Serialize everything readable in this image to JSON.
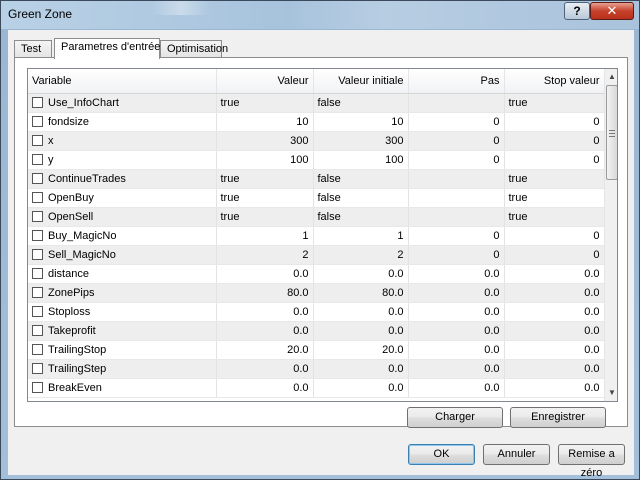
{
  "window": {
    "title": "Green Zone",
    "help_glyph": "?",
    "close_glyph": "✕"
  },
  "tabs": [
    {
      "label": "Test"
    },
    {
      "label": "Parametres d'entrée"
    },
    {
      "label": "Optimisation"
    }
  ],
  "grid": {
    "columns": [
      "Variable",
      "Valeur",
      "Valeur initiale",
      "Pas",
      "Stop valeur"
    ],
    "rows": [
      {
        "name": "Use_InfoChart",
        "valeur": "true",
        "initiale": "false",
        "pas": "",
        "stop": "true",
        "kind": "bool"
      },
      {
        "name": "fondsize",
        "valeur": "10",
        "initiale": "10",
        "pas": "0",
        "stop": "0",
        "kind": "num"
      },
      {
        "name": "x",
        "valeur": "300",
        "initiale": "300",
        "pas": "0",
        "stop": "0",
        "kind": "num"
      },
      {
        "name": "y",
        "valeur": "100",
        "initiale": "100",
        "pas": "0",
        "stop": "0",
        "kind": "num"
      },
      {
        "name": "ContinueTrades",
        "valeur": "true",
        "initiale": "false",
        "pas": "",
        "stop": "true",
        "kind": "bool"
      },
      {
        "name": "OpenBuy",
        "valeur": "true",
        "initiale": "false",
        "pas": "",
        "stop": "true",
        "kind": "bool"
      },
      {
        "name": "OpenSell",
        "valeur": "true",
        "initiale": "false",
        "pas": "",
        "stop": "true",
        "kind": "bool"
      },
      {
        "name": "Buy_MagicNo",
        "valeur": "1",
        "initiale": "1",
        "pas": "0",
        "stop": "0",
        "kind": "num"
      },
      {
        "name": "Sell_MagicNo",
        "valeur": "2",
        "initiale": "2",
        "pas": "0",
        "stop": "0",
        "kind": "num"
      },
      {
        "name": "distance",
        "valeur": "0.0",
        "initiale": "0.0",
        "pas": "0.0",
        "stop": "0.0",
        "kind": "num"
      },
      {
        "name": "ZonePips",
        "valeur": "80.0",
        "initiale": "80.0",
        "pas": "0.0",
        "stop": "0.0",
        "kind": "num"
      },
      {
        "name": "Stoploss",
        "valeur": "0.0",
        "initiale": "0.0",
        "pas": "0.0",
        "stop": "0.0",
        "kind": "num"
      },
      {
        "name": "Takeprofit",
        "valeur": "0.0",
        "initiale": "0.0",
        "pas": "0.0",
        "stop": "0.0",
        "kind": "num"
      },
      {
        "name": "TrailingStop",
        "valeur": "20.0",
        "initiale": "20.0",
        "pas": "0.0",
        "stop": "0.0",
        "kind": "num"
      },
      {
        "name": "TrailingStep",
        "valeur": "0.0",
        "initiale": "0.0",
        "pas": "0.0",
        "stop": "0.0",
        "kind": "num"
      },
      {
        "name": "BreakEven",
        "valeur": "0.0",
        "initiale": "0.0",
        "pas": "0.0",
        "stop": "0.0",
        "kind": "num"
      }
    ]
  },
  "panel_buttons": {
    "charger": "Charger",
    "enregistrer": "Enregistrer"
  },
  "dialog_buttons": {
    "ok": "OK",
    "annuler": "Annuler",
    "reset": "Remise a zéro"
  },
  "scrollbar": {
    "up_glyph": "▲",
    "down_glyph": "▼"
  }
}
